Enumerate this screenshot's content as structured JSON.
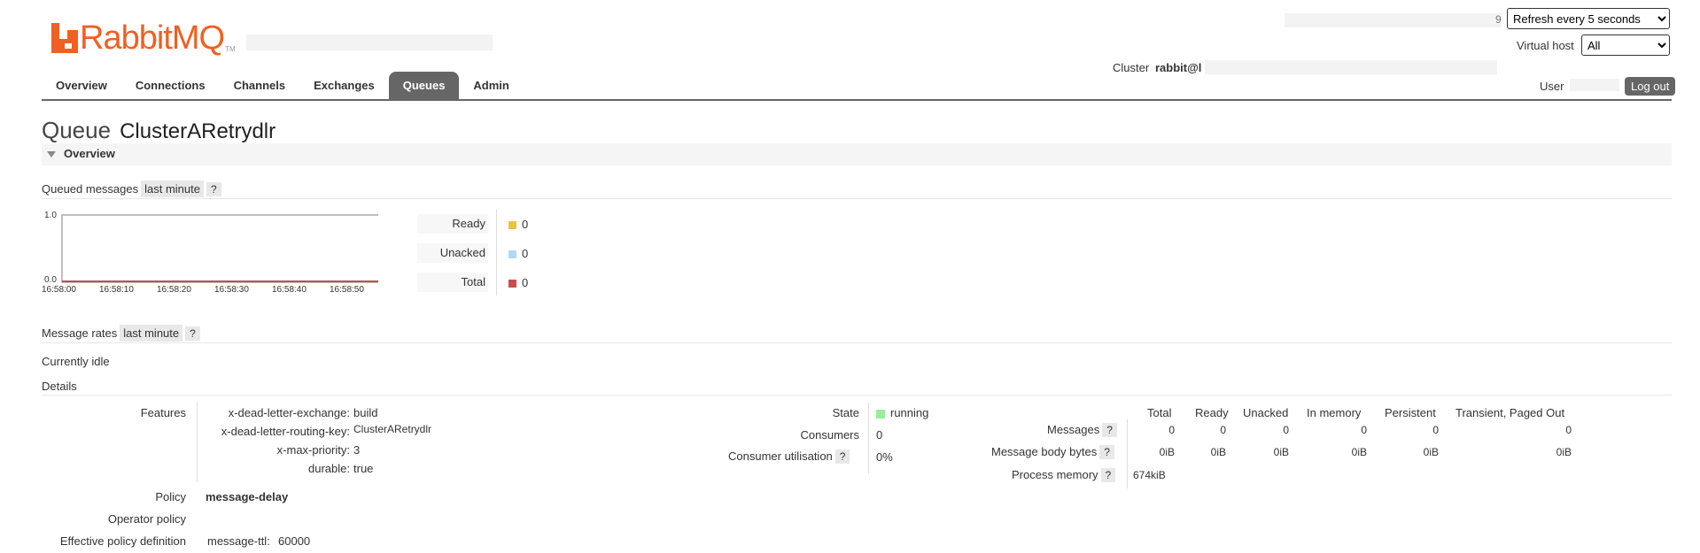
{
  "header": {
    "brand": "RabbitMQ",
    "tm": "TM",
    "refresh_selected": "Refresh every 5 seconds",
    "vhost_label": "Virtual host",
    "vhost_selected": "All",
    "cluster_label": "Cluster",
    "cluster_name": "rabbit@l",
    "user_label": "User",
    "logout_label": "Log out",
    "refresh_partial": "9"
  },
  "nav": {
    "tabs": [
      "Overview",
      "Connections",
      "Channels",
      "Exchanges",
      "Queues",
      "Admin"
    ],
    "active": "Queues"
  },
  "page": {
    "title_prefix": "Queue",
    "queue_name": "ClusterARetrydlr"
  },
  "overview": {
    "section_label": "Overview",
    "queued_label": "Queued messages",
    "queued_range": "last minute",
    "help": "?",
    "chart": {
      "ymax": "1.0",
      "ymin": "0.0",
      "times": [
        "16:58:00",
        "16:58:10",
        "16:58:20",
        "16:58:30",
        "16:58:40",
        "16:58:50"
      ]
    },
    "legend": [
      {
        "label": "Ready",
        "value": "0",
        "color": "#edc240"
      },
      {
        "label": "Unacked",
        "value": "0",
        "color": "#afd8f8"
      },
      {
        "label": "Total",
        "value": "0",
        "color": "#cb4b4b"
      }
    ],
    "rates_label": "Message rates",
    "rates_range": "last minute",
    "idle_text": "Currently idle"
  },
  "details": {
    "label": "Details",
    "features_label": "Features",
    "features": [
      {
        "key": "x-dead-letter-exchange:",
        "value": "build"
      },
      {
        "key": "x-dead-letter-routing-key:",
        "value": "ClusterARetrydlr"
      },
      {
        "key": "x-max-priority:",
        "value": "3"
      },
      {
        "key": "durable:",
        "value": "true"
      }
    ],
    "policy_label": "Policy",
    "policy_value": "message-delay",
    "operator_policy_label": "Operator policy",
    "effective_label": "Effective policy definition",
    "effective_key": "message-ttl:",
    "effective_value": "60000",
    "state_label": "State",
    "state_value": "running",
    "state_color": "#99ee99",
    "consumers_label": "Consumers",
    "consumers_value": "0",
    "util_label": "Consumer utilisation",
    "util_value": "0%",
    "table": {
      "headers": [
        "Total",
        "Ready",
        "Unacked",
        "In memory",
        "Persistent",
        "Transient, Paged Out"
      ],
      "rows": [
        {
          "label": "Messages",
          "values": [
            "0",
            "0",
            "0",
            "0",
            "0",
            "0"
          ]
        },
        {
          "label": "Message body bytes",
          "values": [
            "0iB",
            "0iB",
            "0iB",
            "0iB",
            "0iB",
            "0iB"
          ]
        }
      ],
      "process_label": "Process memory",
      "process_value": "674kiB"
    }
  }
}
